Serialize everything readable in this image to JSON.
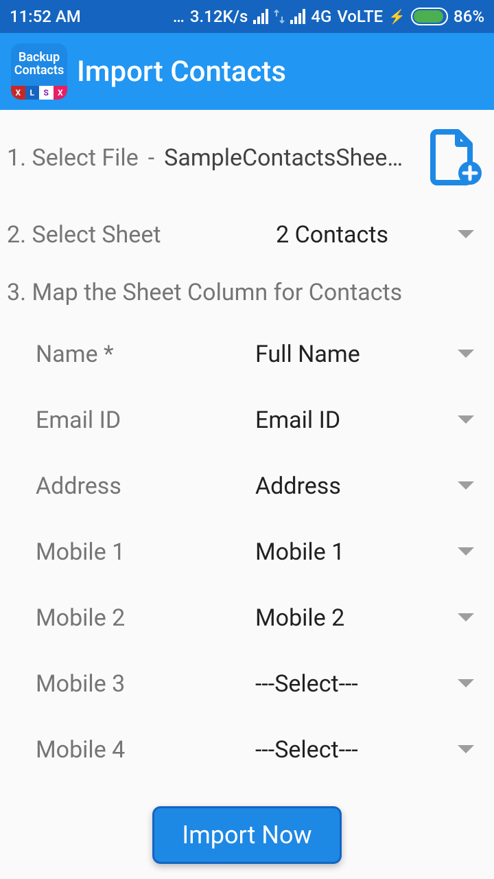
{
  "status": {
    "time": "11:52 AM",
    "speed": "3.12K/s",
    "network": "4G",
    "volte": "VoLTE",
    "battery_pct": "86%"
  },
  "app": {
    "icon_line1": "Backup",
    "icon_line2": "Contacts",
    "icon_strip": [
      "X",
      "L",
      "S",
      "X"
    ],
    "title": "Import Contacts"
  },
  "steps": {
    "file_label": "1. Select File",
    "file_name": "SampleContactsShee…",
    "sheet_label": "2. Select Sheet",
    "sheet_value": "2 Contacts",
    "map_header": "3. Map the Sheet Column for Contacts"
  },
  "mappings": [
    {
      "label": "Name *",
      "value": "Full Name"
    },
    {
      "label": "Email ID",
      "value": "Email ID"
    },
    {
      "label": "Address",
      "value": "Address"
    },
    {
      "label": "Mobile 1",
      "value": "Mobile 1"
    },
    {
      "label": "Mobile 2",
      "value": "Mobile 2"
    },
    {
      "label": "Mobile 3",
      "value": "---Select---"
    },
    {
      "label": "Mobile 4",
      "value": "---Select---"
    }
  ],
  "actions": {
    "import": "Import Now"
  }
}
